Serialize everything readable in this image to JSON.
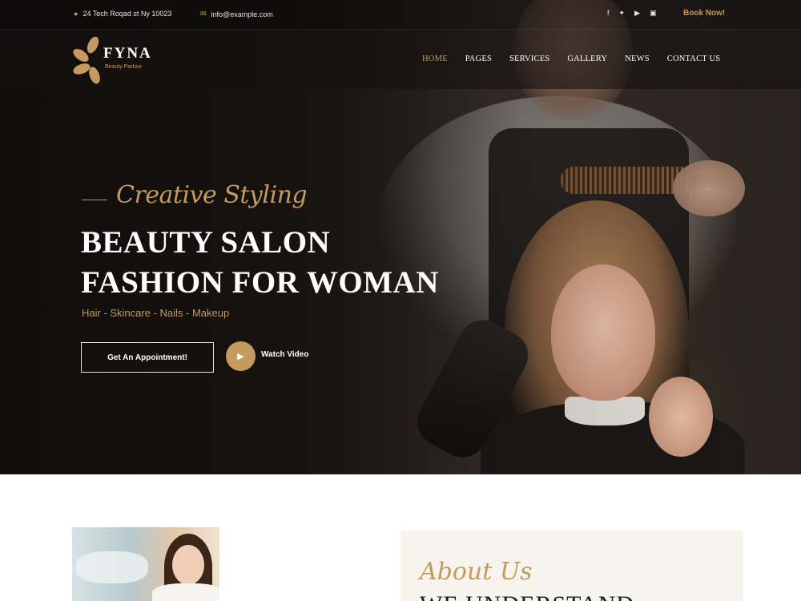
{
  "topbar": {
    "address": "24 Tech Roqad st Ny 10023",
    "email": "info@example.com",
    "address_icon": "map-pin-icon",
    "email_icon": "envelope-icon",
    "socials": [
      "facebook-icon",
      "twitter-icon",
      "youtube-icon",
      "instagram-icon"
    ],
    "book_now": "Book Now!"
  },
  "brand": {
    "name": "FYNA",
    "tagline": "Beauty Parlour"
  },
  "nav": {
    "items": [
      "HOME",
      "PAGES",
      "SERVICES",
      "GALLERY",
      "NEWS",
      "CONTACT US"
    ],
    "active": "HOME"
  },
  "hero": {
    "script": "Creative Styling",
    "title_line1": "BEAUTY SALON",
    "title_line2": "FASHION FOR WOMAN",
    "services": "Hair - Skincare - Nails - Makeup",
    "cta_label": "Get An Appointment!",
    "video_label": "Watch Video"
  },
  "about": {
    "script": "About Us",
    "heading": "WE UNDERSTAND"
  },
  "colors": {
    "accent_gold": "#c49a5e",
    "dark": "#1a1614",
    "light_panel": "#f7f4ee"
  }
}
